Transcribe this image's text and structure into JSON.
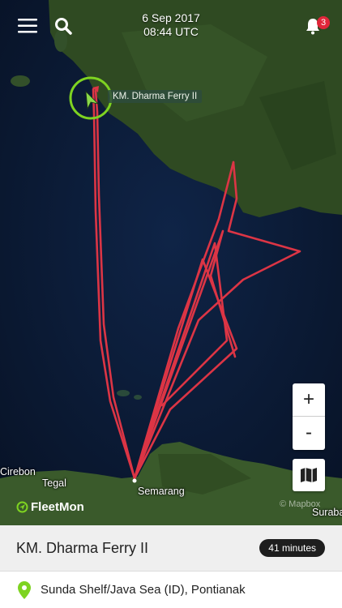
{
  "header": {
    "date": "6 Sep 2017",
    "time": "08:44 UTC",
    "notification_count": "3",
    "icons": {
      "menu": "hamburger-menu-icon",
      "search": "search-icon",
      "notifications": "bell-icon"
    }
  },
  "map": {
    "vessel_label": "KM. Dharma Ferry II",
    "places": {
      "kirebon": "Cirebon",
      "tegal": "Tegal",
      "semarang": "Semarang",
      "surabaya": "Suraba"
    },
    "attribution": "© Mapbox",
    "brand": "FleetMon",
    "colors": {
      "track": "#dc3545",
      "sea": "#0b1a33",
      "land": "#2f4a22",
      "vessel_ring": "#7ed321",
      "vessel_marker": "#8bd94a"
    },
    "controls": {
      "zoom_in": "+",
      "zoom_out": "-",
      "layers_icon": "map-layers-icon"
    }
  },
  "panel": {
    "vessel_name": "KM. Dharma Ferry II",
    "eta": "41 minutes",
    "location": "Sunda Shelf/Java Sea (ID), Pontianak",
    "location_icon": "location-pin-icon",
    "accent": "#7ed321"
  }
}
